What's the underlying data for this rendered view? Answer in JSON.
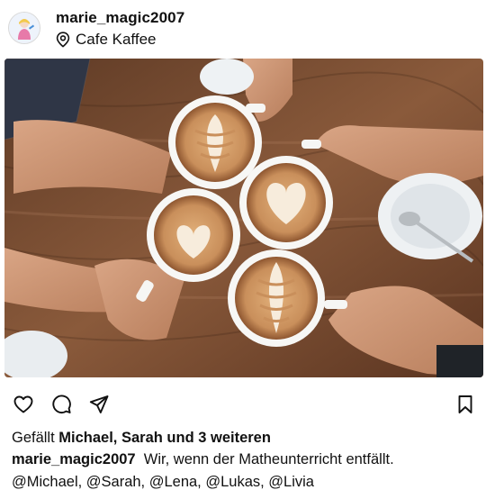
{
  "post": {
    "username": "marie_magic2007",
    "location": "Cafe Kaffee"
  },
  "actions": {
    "icons": [
      "heart-icon",
      "comment-icon",
      "share-icon",
      "bookmark-icon"
    ]
  },
  "likes": {
    "prefix": "Gefällt ",
    "names": "Michael, Sarah und 3 weiteren"
  },
  "caption": {
    "username": "marie_magic2007",
    "text": "Wir, wenn der Matheunterricht entfällt."
  },
  "mentions": "@Michael, @Sarah, @Lena, @Lukas, @Livia",
  "colors": {
    "text": "#111111",
    "table_wood": "#7a4d31",
    "latte_foam": "#c98f5b"
  }
}
